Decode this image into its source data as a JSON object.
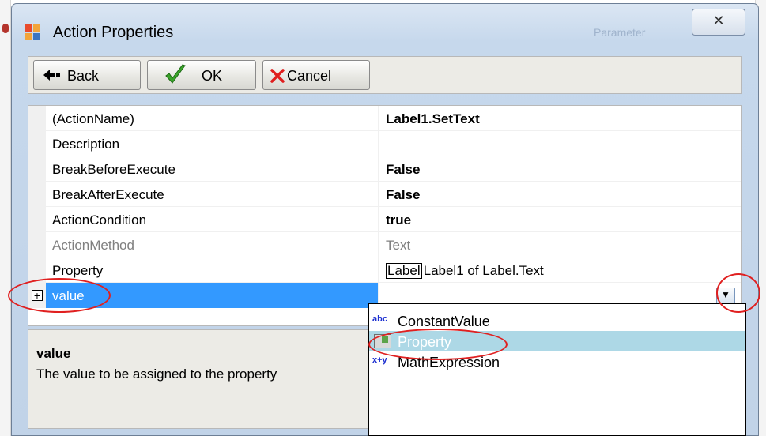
{
  "window": {
    "title": "Action Properties",
    "background_title": "Parameter",
    "close_glyph": "✕"
  },
  "toolbar": {
    "back_label": "Back",
    "ok_label": "OK",
    "cancel_label": "Cancel"
  },
  "grid": {
    "rows": [
      {
        "name": "(ActionName)",
        "value": "Label1.SetText"
      },
      {
        "name": "Description",
        "value": ""
      },
      {
        "name": "BreakBeforeExecute",
        "value": "False"
      },
      {
        "name": "BreakAfterExecute",
        "value": "False"
      },
      {
        "name": "ActionCondition",
        "value": "true"
      },
      {
        "name": "ActionMethod",
        "value": "Text"
      },
      {
        "name": "Property",
        "icon_text": "Label",
        "value": "Label1 of Label.Text"
      },
      {
        "name": "value",
        "value": ""
      }
    ]
  },
  "description": {
    "title": "value",
    "text": "The value to be assigned to the property"
  },
  "dropdown": {
    "options": [
      {
        "icon": "abc",
        "label": "ConstantValue"
      },
      {
        "icon": "property-icon",
        "label": "Property"
      },
      {
        "icon": "x+y",
        "label": "MathExpression"
      }
    ],
    "selected": "Property"
  },
  "colors": {
    "selection": "#3399ff",
    "dropdown_highlight": "#add8e6",
    "annotation": "#e02020"
  }
}
